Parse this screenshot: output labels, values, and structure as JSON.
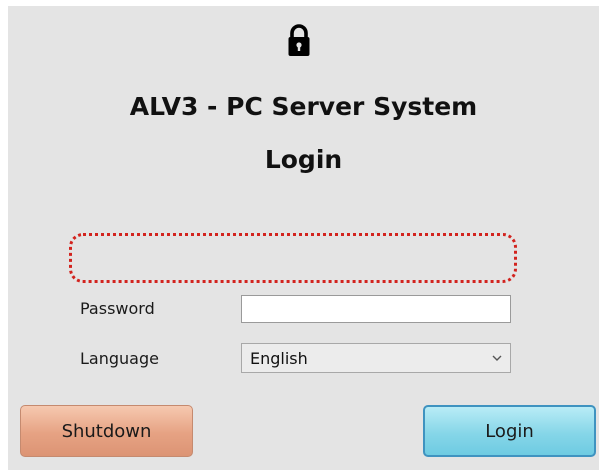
{
  "window": {
    "title": "ALV3 - PC Server System",
    "subtitle": "Login"
  },
  "icons": {
    "lock": "lock-icon",
    "dropdown": "chevron-down-icon"
  },
  "form": {
    "password_label": "Password",
    "password_value": "",
    "language_label": "Language",
    "language_selected": "English"
  },
  "buttons": {
    "shutdown_label": "Shutdown",
    "login_label": "Login"
  },
  "colors": {
    "highlight": "#d2231e",
    "shutdown": "#e6a283",
    "login": "#86d6e8"
  }
}
